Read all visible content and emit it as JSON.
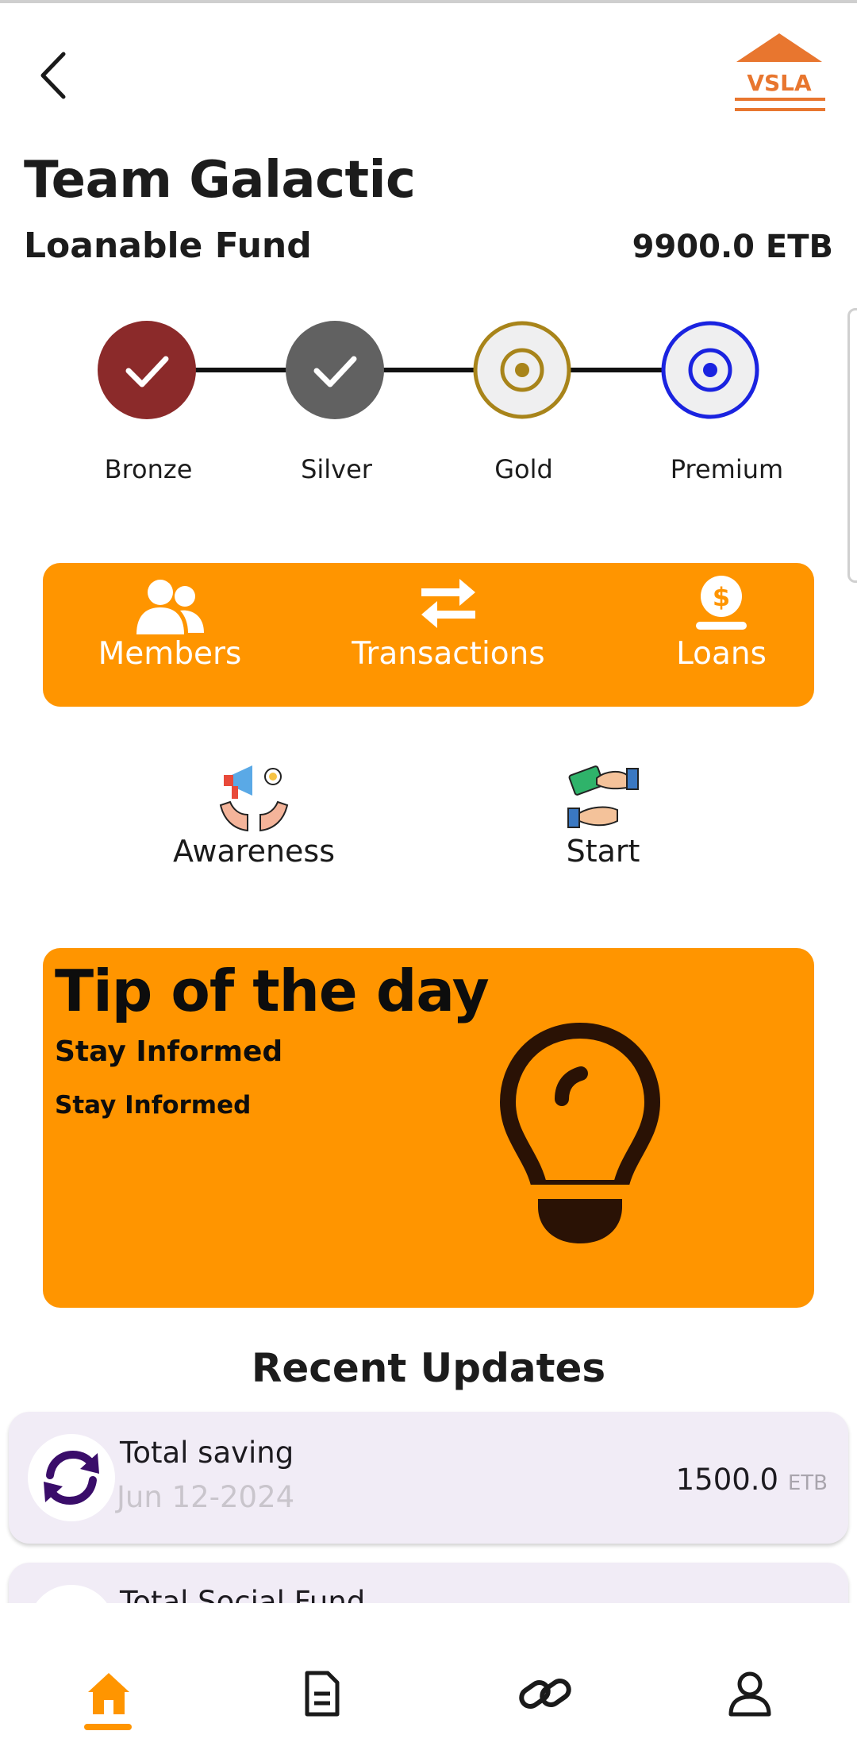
{
  "header": {
    "logo_text": "VSLA",
    "team_name": "Team Galactic",
    "fund_label": "Loanable Fund",
    "fund_value": "9900.0 ETB"
  },
  "levels": [
    {
      "label": "Bronze",
      "state": "done",
      "color": "#8b2a2a"
    },
    {
      "label": "Silver",
      "state": "done",
      "color": "#616161"
    },
    {
      "label": "Gold",
      "state": "current",
      "color": "#a8841a"
    },
    {
      "label": "Premium",
      "state": "current",
      "color": "#1a23e0"
    }
  ],
  "menu": {
    "members_label": "Members",
    "transactions_label": "Transactions",
    "loans_label": "Loans"
  },
  "tools": {
    "awareness_label": "Awareness",
    "start_label": "Start"
  },
  "tip": {
    "title": "Tip of the day",
    "heading": "Stay Informed",
    "body": "Stay Informed"
  },
  "updates": {
    "title": "Recent Updates",
    "items": [
      {
        "name": "Total saving",
        "date": "Jun 12-2024",
        "amount": "1500.0",
        "currency": "ETB"
      },
      {
        "name": "Total Social Fund",
        "date": "",
        "amount": "",
        "currency": ""
      }
    ]
  },
  "nav": [
    "home-icon",
    "document-icon",
    "link-icon",
    "profile-icon"
  ],
  "colors": {
    "accent": "#ff9500",
    "card_bg": "#f1ecf6"
  }
}
